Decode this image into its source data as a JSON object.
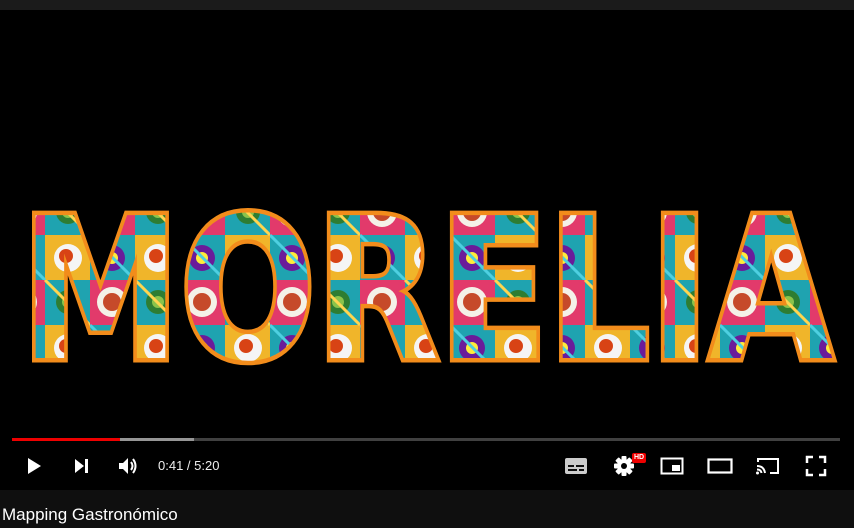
{
  "video": {
    "overlay_text": "MORELIA"
  },
  "player": {
    "progress_played": 0.13,
    "progress_buffered": 0.22,
    "current_time": "0:41",
    "separator": " / ",
    "duration": "5:20",
    "quality_badge": "HD",
    "accent_color": "#ee0000"
  },
  "icons": [
    "play-icon",
    "next-icon",
    "volume-icon",
    "subtitles-icon",
    "settings-icon",
    "miniplayer-icon",
    "theater-mode-icon",
    "cast-icon",
    "fullscreen-icon"
  ],
  "channel": {
    "title": "Mapping Gastronómico"
  }
}
